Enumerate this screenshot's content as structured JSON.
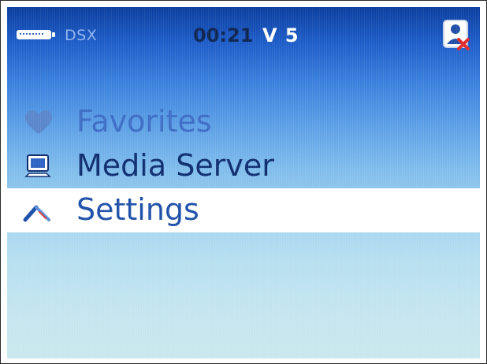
{
  "status_bar": {
    "battery_icon": "battery-icon",
    "device_label": "DSX",
    "clock": "00:21",
    "version": "V 5",
    "user_icon": "user-remove-icon"
  },
  "menu": {
    "items": [
      {
        "label": "Favorites",
        "icon": "heart-icon",
        "state": "dimmed"
      },
      {
        "label": "Media Server",
        "icon": "computer-icon",
        "state": "normal"
      },
      {
        "label": "Settings",
        "icon": "wrench-icon",
        "state": "selected"
      }
    ],
    "selected_index": 2
  },
  "colors": {
    "background_top": "#0a3e9e",
    "background_bottom": "#c9e8ee",
    "selection_highlight": "#ffffff",
    "label_text": "#0e2c6e",
    "selected_label_text": "#1d4fa8",
    "dimmed_label_text": "#3d6cc4"
  }
}
